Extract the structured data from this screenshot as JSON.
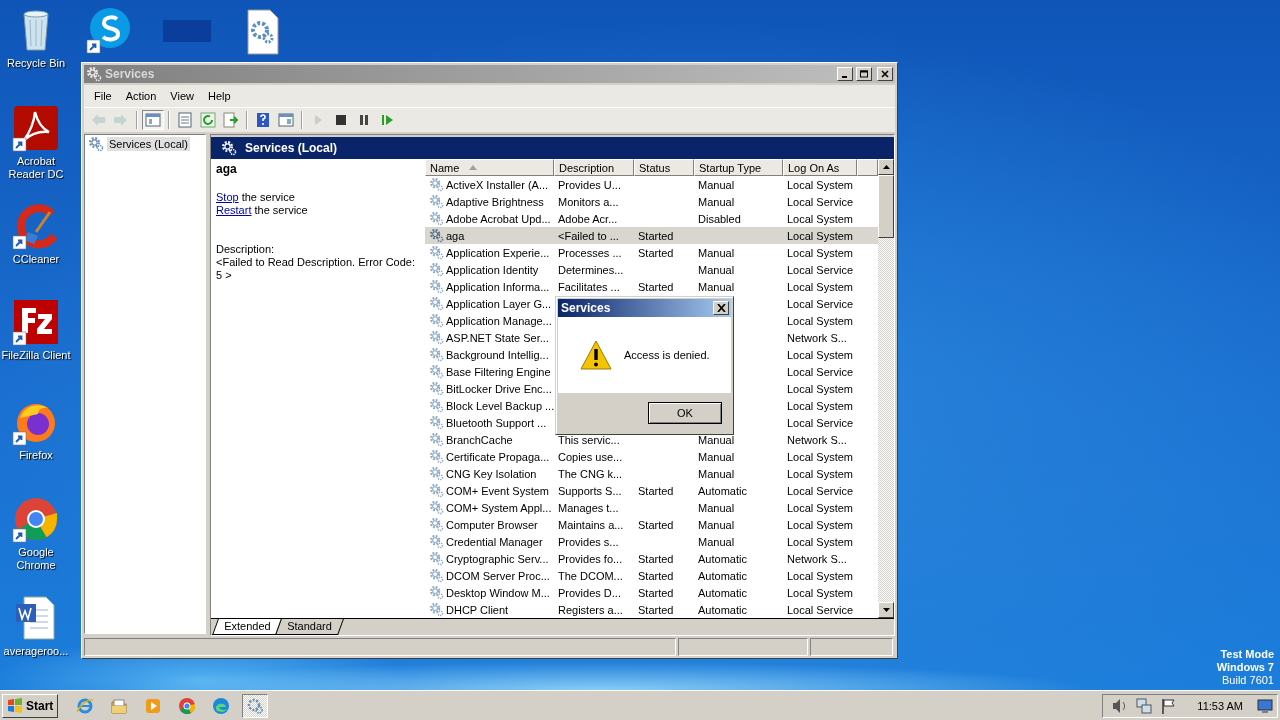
{
  "desktop_icons": [
    {
      "label": "Recycle Bin",
      "kind": "bin"
    },
    {
      "label": "Acrobat Reader DC",
      "kind": "acrobat"
    },
    {
      "label": "CCleaner",
      "kind": "ccleaner"
    },
    {
      "label": "FileZilla Client",
      "kind": "filezilla"
    },
    {
      "label": "Firefox",
      "kind": "firefox"
    },
    {
      "label": "Google Chrome",
      "kind": "chrome"
    },
    {
      "label": "averageroo...",
      "kind": "word"
    }
  ],
  "top_icons": [
    {
      "kind": "skype"
    },
    {
      "kind": "blank"
    },
    {
      "kind": "config"
    }
  ],
  "window": {
    "title": "Services",
    "menu": [
      "File",
      "Action",
      "View",
      "Help"
    ],
    "toolbar": [
      {
        "kind": "back",
        "disabled": true
      },
      {
        "kind": "forward",
        "disabled": true
      },
      {
        "kind": "tree",
        "disabled": false
      },
      {
        "kind": "properties",
        "disabled": false
      },
      {
        "kind": "refresh",
        "disabled": false
      },
      {
        "kind": "export",
        "disabled": false
      },
      {
        "kind": "help",
        "disabled": false
      },
      {
        "kind": "pane",
        "disabled": false
      },
      {
        "kind": "play",
        "disabled": true
      },
      {
        "kind": "stop",
        "disabled": false
      },
      {
        "kind": "pause",
        "disabled": false
      },
      {
        "kind": "resume",
        "disabled": false
      }
    ],
    "tree": [
      {
        "label": "Services (Local)",
        "selected": true
      }
    ],
    "header": "Services (Local)",
    "details": {
      "name": "aga",
      "actions": [
        {
          "link": "Stop",
          "rest": "the service"
        },
        {
          "link": "Restart",
          "rest": "the service"
        }
      ],
      "description_label": "Description:",
      "description": "<Failed to Read Description. Error Code: 5 >"
    },
    "columns": [
      {
        "label": "Name",
        "sorted": true
      },
      {
        "label": "Description",
        "sorted": false
      },
      {
        "label": "Status",
        "sorted": false
      },
      {
        "label": "Startup Type",
        "sorted": false
      },
      {
        "label": "Log On As",
        "sorted": false
      }
    ],
    "rows": [
      {
        "name": "ActiveX Installer (A...",
        "description": "Provides U...",
        "status": "",
        "startup": "Manual",
        "logon": "Local System",
        "selected": false
      },
      {
        "name": "Adaptive Brightness",
        "description": "Monitors a...",
        "status": "",
        "startup": "Manual",
        "logon": "Local Service",
        "selected": false
      },
      {
        "name": "Adobe Acrobat Upd...",
        "description": "Adobe Acr...",
        "status": "",
        "startup": "Disabled",
        "logon": "Local System",
        "selected": false
      },
      {
        "name": "aga",
        "description": "<Failed to ...",
        "status": "Started",
        "startup": "",
        "logon": "Local System",
        "selected": true
      },
      {
        "name": "Application Experie...",
        "description": "Processes ...",
        "status": "Started",
        "startup": "Manual",
        "logon": "Local System",
        "selected": false
      },
      {
        "name": "Application Identity",
        "description": "Determines...",
        "status": "",
        "startup": "Manual",
        "logon": "Local Service",
        "selected": false
      },
      {
        "name": "Application Informa...",
        "description": "Facilitates ...",
        "status": "Started",
        "startup": "Manual",
        "logon": "Local System",
        "selected": false
      },
      {
        "name": "Application Layer G...",
        "description": "",
        "status": "",
        "startup": "",
        "logon": "Local Service",
        "selected": false
      },
      {
        "name": "Application Manage...",
        "description": "",
        "status": "",
        "startup": "",
        "logon": "Local System",
        "selected": false
      },
      {
        "name": "ASP.NET State Ser...",
        "description": "",
        "status": "",
        "startup": "",
        "logon": "Network S...",
        "selected": false
      },
      {
        "name": "Background Intellig...",
        "description": "",
        "status": "",
        "startup": "",
        "logon": "Local System",
        "selected": false
      },
      {
        "name": "Base Filtering Engine",
        "description": "",
        "status": "",
        "startup": "",
        "logon": "Local Service",
        "selected": false
      },
      {
        "name": "BitLocker Drive Enc...",
        "description": "",
        "status": "",
        "startup": "",
        "logon": "Local System",
        "selected": false
      },
      {
        "name": "Block Level Backup ...",
        "description": "",
        "status": "",
        "startup": "",
        "logon": "Local System",
        "selected": false
      },
      {
        "name": "Bluetooth Support ...",
        "description": "",
        "status": "",
        "startup": "",
        "logon": "Local Service",
        "selected": false
      },
      {
        "name": "BranchCache",
        "description": "This servic...",
        "status": "",
        "startup": "Manual",
        "logon": "Network S...",
        "selected": false
      },
      {
        "name": "Certificate Propaga...",
        "description": "Copies use...",
        "status": "",
        "startup": "Manual",
        "logon": "Local System",
        "selected": false
      },
      {
        "name": "CNG Key Isolation",
        "description": "The CNG k...",
        "status": "",
        "startup": "Manual",
        "logon": "Local System",
        "selected": false
      },
      {
        "name": "COM+ Event System",
        "description": "Supports S...",
        "status": "Started",
        "startup": "Automatic",
        "logon": "Local Service",
        "selected": false
      },
      {
        "name": "COM+ System Appl...",
        "description": "Manages t...",
        "status": "",
        "startup": "Manual",
        "logon": "Local System",
        "selected": false
      },
      {
        "name": "Computer Browser",
        "description": "Maintains a...",
        "status": "Started",
        "startup": "Manual",
        "logon": "Local System",
        "selected": false
      },
      {
        "name": "Credential Manager",
        "description": "Provides s...",
        "status": "",
        "startup": "Manual",
        "logon": "Local System",
        "selected": false
      },
      {
        "name": "Cryptographic Serv...",
        "description": "Provides fo...",
        "status": "Started",
        "startup": "Automatic",
        "logon": "Network S...",
        "selected": false
      },
      {
        "name": "DCOM Server Proc...",
        "description": "The DCOM...",
        "status": "Started",
        "startup": "Automatic",
        "logon": "Local System",
        "selected": false
      },
      {
        "name": "Desktop Window M...",
        "description": "Provides D...",
        "status": "Started",
        "startup": "Automatic",
        "logon": "Local System",
        "selected": false
      },
      {
        "name": "DHCP Client",
        "description": "Registers a...",
        "status": "Started",
        "startup": "Automatic",
        "logon": "Local Service",
        "selected": false
      }
    ],
    "tabs": [
      {
        "label": "Extended",
        "selected": true
      },
      {
        "label": "Standard",
        "selected": false
      }
    ]
  },
  "dialog": {
    "title": "Services",
    "message": "Access is denied.",
    "button": "OK"
  },
  "os_notice": [
    "Test Mode",
    "Windows 7",
    "Build 7601"
  ],
  "taskbar": {
    "start": "Start",
    "apps": [
      {
        "kind": "ie",
        "active": false
      },
      {
        "kind": "explorer",
        "active": false
      },
      {
        "kind": "media",
        "active": false
      },
      {
        "kind": "chrome",
        "active": false
      },
      {
        "kind": "edge",
        "active": false
      },
      {
        "kind": "services",
        "active": true
      }
    ],
    "tray": [
      {
        "kind": "speaker"
      },
      {
        "kind": "network"
      },
      {
        "kind": "flag"
      }
    ],
    "clock": "11:53 AM"
  }
}
